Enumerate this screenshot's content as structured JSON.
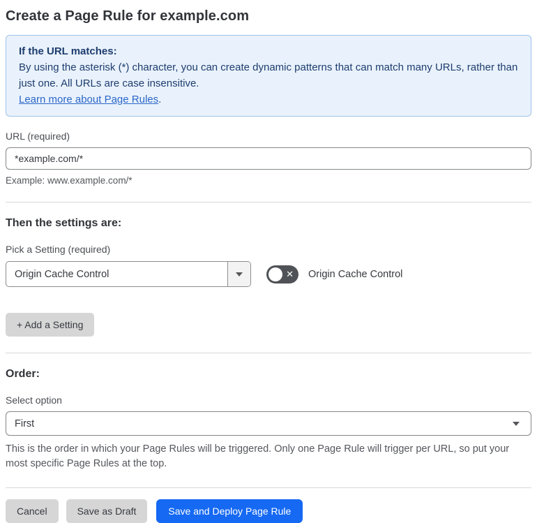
{
  "page": {
    "title": "Create a Page Rule for example.com"
  },
  "info_box": {
    "heading": "If the URL matches:",
    "body": "By using the asterisk (*) character, you can create dynamic patterns that can match many URLs, rather than just one. All URLs are case insensitive.",
    "link": "Learn more about Page Rules",
    "link_suffix": "."
  },
  "url_section": {
    "label": "URL (required)",
    "value": "*example.com/*",
    "helper": "Example: www.example.com/*"
  },
  "settings_section": {
    "heading": "Then the settings are:",
    "picker_label": "Pick a Setting (required)",
    "picker_value": "Origin Cache Control",
    "toggle_state": "off",
    "toggle_x": "✕",
    "toggle_label": "Origin Cache Control",
    "add_button": "+ Add a Setting"
  },
  "order_section": {
    "heading": "Order:",
    "select_label": "Select option",
    "select_value": "First",
    "helper": "This is the order in which your Page Rules will be triggered. Only one Page Rule will trigger per URL, so put your most specific Page Rules at the top."
  },
  "footer": {
    "cancel": "Cancel",
    "save_draft": "Save as Draft",
    "save_deploy": "Save and Deploy Page Rule"
  },
  "colors": {
    "primary_blue": "#1569f2",
    "info_background": "#e9f2fc",
    "info_border": "#9ec2e9",
    "info_text": "#1d3c6e",
    "link_blue": "#2b66c8",
    "toggle_off_background": "#4f5256",
    "button_gray": "#d6d6d6"
  }
}
